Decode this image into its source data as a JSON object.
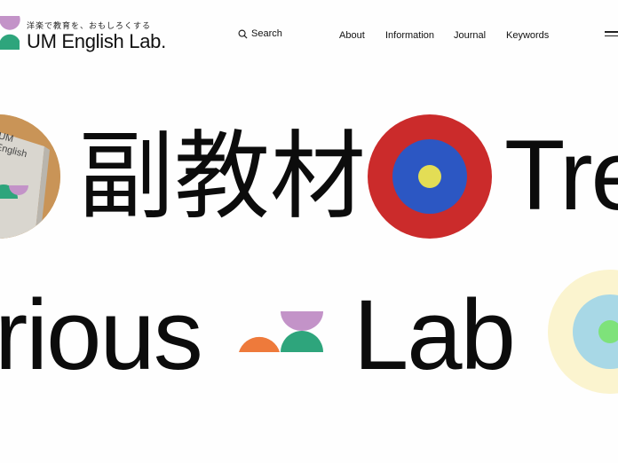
{
  "logo": {
    "tagline": "洋楽で教育を、おもしろくする",
    "name": "UM English Lab.",
    "icon": "um-logo-mark"
  },
  "search": {
    "label": "Search",
    "icon": "search-icon"
  },
  "nav": {
    "items": [
      "About",
      "Information",
      "Journal",
      "Keywords"
    ]
  },
  "menu": {
    "icon": "hamburger-menu-icon"
  },
  "marquee": {
    "row1": {
      "word_jp": "副教材",
      "word_en": "Tre"
    },
    "row2": {
      "word_a": "rious",
      "word_b": "Lab"
    },
    "book_cover_text": "UM English"
  },
  "colors": {
    "red": "#cb2b2b",
    "blue": "#2c57c3",
    "yellow": "#e3dd55",
    "purple": "#c393c8",
    "green": "#2ea57c",
    "orange": "#ee7a3b",
    "pale_yellow": "#fbf4cf",
    "light_blue": "#a8d8e6",
    "light_green": "#7ee27a"
  }
}
